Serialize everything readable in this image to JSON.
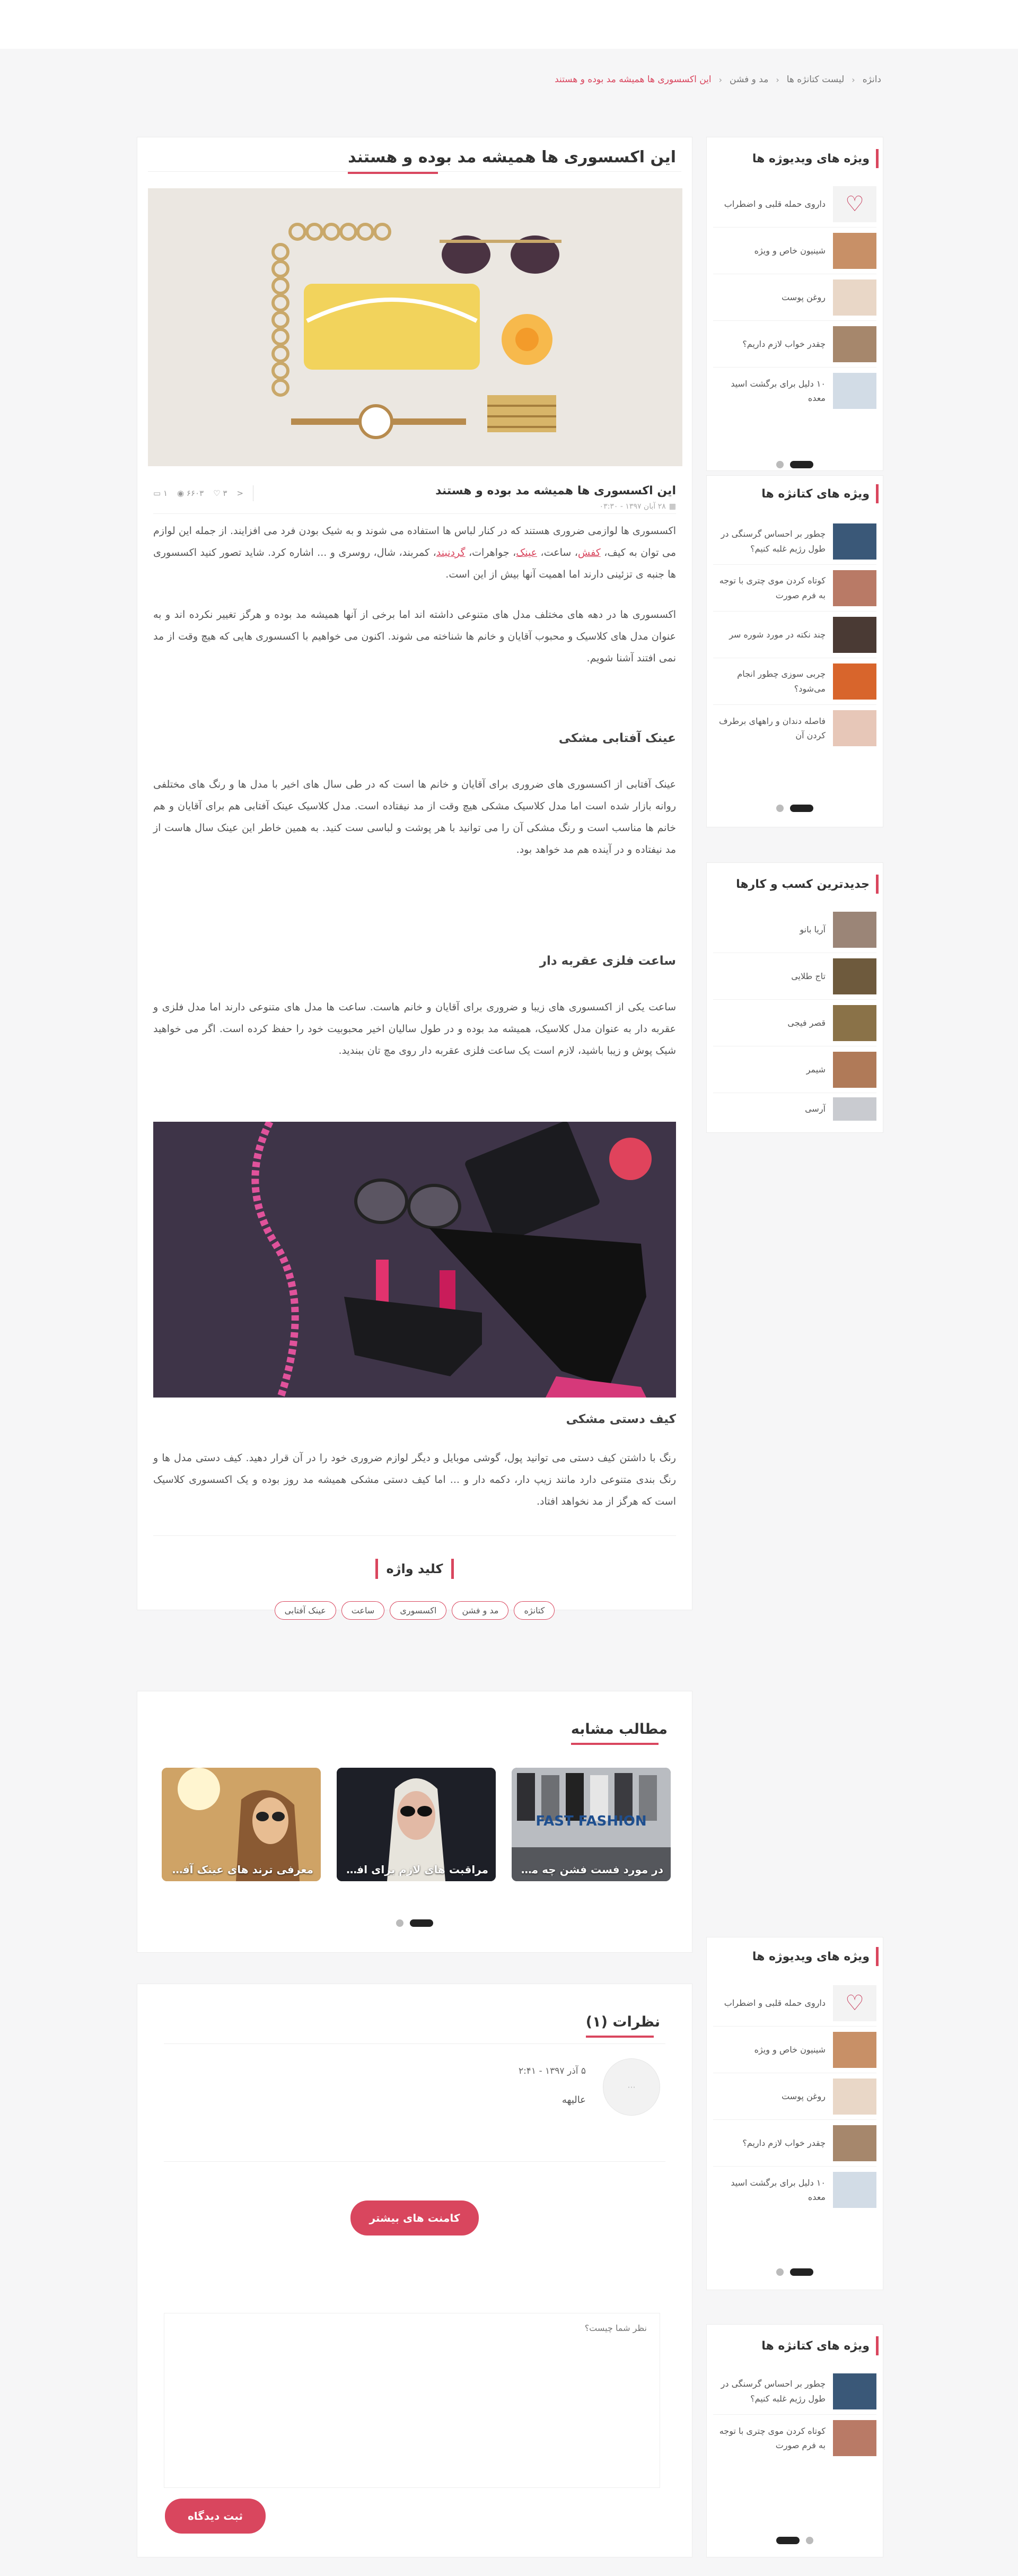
{
  "breadcrumb": {
    "items": [
      "دانژه",
      "لیست کتانژه ها",
      "مد و فشن"
    ],
    "current": "این اکسسوری ها همیشه مد بوده و هستند"
  },
  "article": {
    "title": "این اکسسوری ها همیشه مد بوده و هستند",
    "meta": {
      "title": "این اکسسوری ها همیشه مد بوده و هستند",
      "date": "۲۸ آبان ۱۳۹۷ - ۰۳:۳۰",
      "comments": "۱",
      "views": "۶۶۰۳",
      "likes": "۳"
    },
    "p1_a": "اکسسوری ها لوازمی ضروری هستند که در کنار لباس ها استفاده می شوند و به شیک بودن فرد می افزایند. از جمله این لوازم می توان به کیف، ",
    "p1_link1": "کفش",
    "p1_b": "، ساعت، ",
    "p1_link2": "عینک",
    "p1_c": "، جواهرات، ",
    "p1_link3": "گردنبند",
    "p1_d": "، کمربند، شال، روسری و ... اشاره کرد. شاید تصور کنید اکسسوری ها جنبه ی تزئینی دارند اما اهمیت آنها بیش از این است.",
    "p2": "اکسسوری ها در دهه های مختلف مدل های متنوعی داشته اند اما برخی از آنها همیشه مد بوده و هرگز تغییر نکرده اند و به عنوان مدل های کلاسیک و محبوب آقایان و خانم ها شناخته می شوند. اکنون می خواهیم با اکسسوری هایی که هیچ وقت از مد نمی افتند آشنا شویم.",
    "h1": "عینک آفتابی مشکی",
    "p3": "عینک آفتابی از اکسسوری های ضروری برای آقایان و خانم ها است که در طی سال های اخیر با مدل ها و رنگ های مختلفی روانه بازار شده است اما مدل کلاسیک مشکی هیچ وقت از مد نیفتاده است. مدل کلاسیک عینک آفتابی هم برای آقایان و هم خانم ها مناسب است و رنگ مشکی آن را می توانید با هر پوشت و لباسی ست کنید. به همین خاطر این عینک سال هاست از مد نیفتاده و در آینده هم مد خواهد بود.",
    "h2": "ساعت فلزی عقربه دار",
    "p4": "ساعت یکی از اکسسوری های زیبا و ضروری برای آقایان و خانم هاست. ساعت ها مدل های متنوعی دارند اما مدل فلزی و عقربه دار به عنوان مدل کلاسیک، همیشه مد بوده و در طول سالیان اخیر محبوبیت خود را حفظ کرده است. اگر می خواهید شیک پوش و زیبا باشید، لازم است یک ساعت فلزی عقربه دار روی مچ تان ببندید.",
    "h3": "کیف دستی مشکی",
    "p5": "رنگ با داشتن کیف دستی می توانید پول، گوشی موبایل و دیگر لوازم ضروری خود را در آن قرار دهید. کیف دستی مدل ها و رنگ بندی متنوعی دارد مانند زیپ دار، دکمه دار و ... اما کیف دستی مشکی همیشه مد روز بوده و یک اکسسوری کلاسیک است که هرگز از مد نخواهد افتاد.",
    "keywords_title": "کلید واژه",
    "tags": [
      "کتانژه",
      "مد و فشن",
      "اکسسوری",
      "ساعت",
      "عینک آفتابی"
    ]
  },
  "related": {
    "title": "مطالب مشابه",
    "items": [
      "در مورد فست فشن چه می...",
      "مراقبت های لازم برای افزای...",
      "معرفی ترند های عینک آفتا..."
    ],
    "fast_fashion_text": "FAST FASHION"
  },
  "comments": {
    "title": "نظرات (۱)",
    "date": "۵ آذر ۱۳۹۷ - ۲:۴۱",
    "text": "عالیهه",
    "more_label": "کامنت های بیشتر",
    "placeholder": "نظر شما چیست؟",
    "submit_label": "ثبت دیدگاه"
  },
  "sidebar": {
    "video_title": "ویژه های ویدیوژه ها",
    "video_items": [
      "داروی حمله قلبی و اضطراب",
      "شینیون خاص و ویژه",
      "روغن پوست",
      "چقدر خواب لازم داریم؟",
      "۱۰ دلیل برای برگشت اسید معده"
    ],
    "katanzhe_title": "ویژه های کتانژه ها",
    "katanzhe_items": [
      "چطور بر احساس گرسنگی در طول رژیم غلبه کنیم؟",
      "کوتاه کردن موی چتری با توجه به فرم صورت",
      "چند نکته در مورد شوره سر",
      "چربی سوزی چطور انجام می‌شود؟",
      "فاصله دندان و راههای برطرف کردن آن"
    ],
    "business_title": "جدیدترین کسب و کارها",
    "business_items": [
      "آریا بانو",
      "تاج طلایی",
      "قصر فیجی",
      "شیمر",
      "آرسی"
    ],
    "video2_items": [
      "داروی حمله قلبی و اضطراب",
      "شینیون خاص و ویژه",
      "روغن پوست",
      "چقدر خواب لازم داریم؟",
      "۱۰ دلیل برای برگشت اسید معده"
    ],
    "katanzhe2_items": [
      "چطور بر احساس گرسنگی در طول رژیم غلبه کنیم؟",
      "کوتاه کردن موی چتری با توجه به فرم صورت"
    ]
  },
  "colors": {
    "accent": "#d9465e",
    "background": "#f6f6f7"
  }
}
